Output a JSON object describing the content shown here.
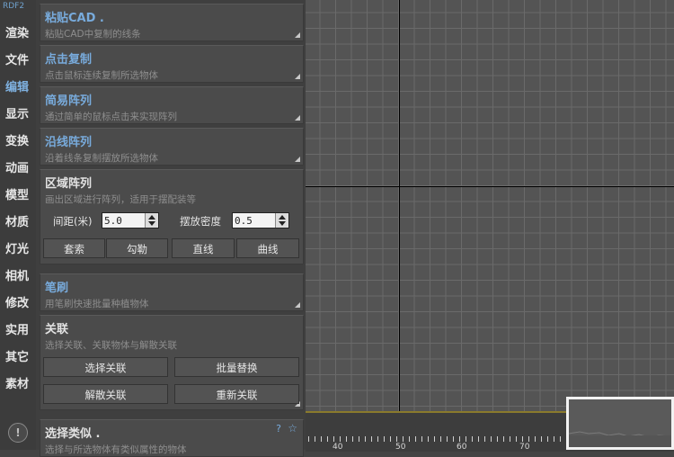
{
  "app": {
    "logo": "RDF2"
  },
  "nav": {
    "items": [
      "渲染",
      "文件",
      "编辑",
      "显示",
      "变换",
      "动画",
      "模型",
      "材质",
      "灯光",
      "相机",
      "修改",
      "实用",
      "其它",
      "素材"
    ],
    "active": "编辑",
    "info_glyph": "!"
  },
  "rollouts": {
    "paste_cad": {
      "title": "粘贴CAD .",
      "subtitle": "粘贴CAD中复制的线条"
    },
    "click_copy": {
      "title": "点击复制",
      "subtitle": "点击鼠标连续复制所选物体"
    },
    "simple_array": {
      "title": "简易阵列",
      "subtitle": "通过简单的鼠标点击来实现阵列"
    },
    "line_array": {
      "title": "沿线阵列",
      "subtitle": "沿着线条复制摆放所选物体"
    },
    "region_array": {
      "title": "区域阵列",
      "subtitle": "画出区域进行阵列，适用于摆配装等",
      "spacing_label": "间距(米)",
      "spacing_value": "5.0",
      "density_label": "摆放密度",
      "density_value": "0.5",
      "buttons": [
        "套索",
        "勾勒",
        "直线",
        "曲线"
      ]
    },
    "brush": {
      "title": "笔刷",
      "subtitle": "用笔刷快速批量种植物体"
    },
    "link": {
      "title": "关联",
      "subtitle": "选择关联、关联物体与解散关联",
      "buttons": [
        "选择关联",
        "批量替换",
        "解散关联",
        "重新关联"
      ]
    },
    "select_similar": {
      "title": "选择类似 .",
      "subtitle": "选择与所选物体有类似属性的物体",
      "help": "?",
      "star": "☆"
    }
  },
  "timeline": {
    "ticks": [
      "40",
      "50",
      "60",
      "70"
    ]
  },
  "colors": {
    "accent": "#78abdc",
    "axis": "#000000",
    "timeline_bar": "#8a7a2c"
  }
}
